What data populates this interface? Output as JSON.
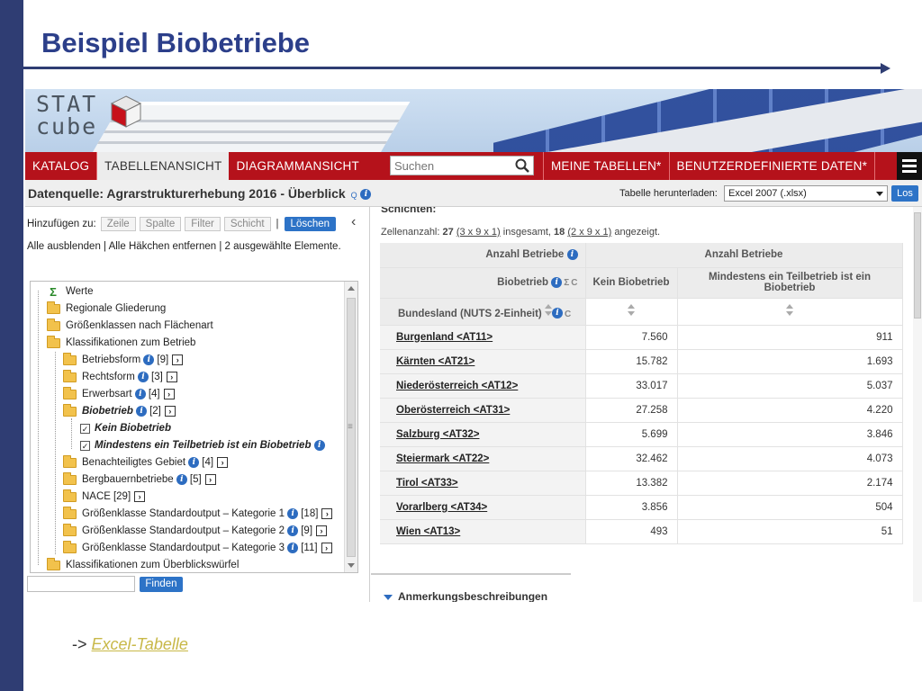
{
  "slide": {
    "title": "Beispiel Biobetriebe",
    "excel_prefix": "->",
    "excel_link": "Excel-Tabelle"
  },
  "app": {
    "logo_line1": "STAT",
    "logo_line2": "cube",
    "nav": {
      "katalog": "KATALOG",
      "tabellenansicht": "TABELLENANSICHT",
      "diagrammansicht": "DIAGRAMMANSICHT",
      "search_placeholder": "Suchen",
      "meine_tabellen": "MEINE TABELLEN*",
      "benutzerdefinierte": "BENUTZERDEFINIERTE DATEN*"
    },
    "toolbar": {
      "datasource": "Datenquelle: Agrarstrukturerhebung 2016 - Überblick",
      "datasource_icon_q": "Q",
      "download_label": "Tabelle herunterladen:",
      "download_format": "Excel 2007 (.xlsx)",
      "download_btn": "Los"
    },
    "left": {
      "add_label": "Hinzufügen zu:",
      "btn_zeile": "Zeile",
      "btn_spalte": "Spalte",
      "btn_filter": "Filter",
      "btn_schicht": "Schicht",
      "separator": "|",
      "btn_loeschen": "Löschen",
      "links": "Alle ausblenden | Alle Häkchen entfernen | 2 ausgewählte Elemente.",
      "find_btn": "Finden",
      "tree": [
        {
          "label": "Werte",
          "count": ""
        },
        {
          "label": "Regionale Gliederung",
          "count": ""
        },
        {
          "label": "Größenklassen nach Flächenart",
          "count": ""
        },
        {
          "label": "Klassifikationen zum Betrieb",
          "count": ""
        },
        {
          "label": "Betriebsform",
          "count": "[9]"
        },
        {
          "label": "Rechtsform",
          "count": "[3]"
        },
        {
          "label": "Erwerbsart",
          "count": "[4]"
        },
        {
          "label": "Biobetrieb",
          "count": "[2]"
        },
        {
          "label": "Kein Biobetrieb",
          "count": ""
        },
        {
          "label": "Mindestens ein Teilbetrieb ist ein Biobetrieb",
          "count": ""
        },
        {
          "label": "Benachteiligtes Gebiet",
          "count": "[4]"
        },
        {
          "label": "Bergbauernbetriebe",
          "count": "[5]"
        },
        {
          "label": "NACE",
          "count": "[29]"
        },
        {
          "label": "Größenklasse Standardoutput – Kategorie 1",
          "count": "[18]"
        },
        {
          "label": "Größenklasse Standardoutput – Kategorie 2",
          "count": "[9]"
        },
        {
          "label": "Größenklasse Standardoutput – Kategorie 3",
          "count": "[11]"
        },
        {
          "label": "Klassifikationen zum Überblickswürfel",
          "count": ""
        }
      ]
    },
    "right": {
      "schichten": "Schichten:",
      "zellen_prefix": "Zellenanzahl:",
      "zellen_total": "27",
      "zellen_dims1": "(3 x 9 x 1)",
      "zellen_mid": "insgesamt,",
      "zellen_shown": "18",
      "zellen_dims2": "(2 x 9 x 1)",
      "zellen_suffix": "angezeigt.",
      "hdr_anzahl_left": "Anzahl Betriebe",
      "hdr_anzahl_right": "Anzahl Betriebe",
      "hdr_bio_left": "Biobetrieb",
      "hdr_col1": "Kein Biobetrieb",
      "hdr_col2": "Mindestens ein Teilbetrieb ist ein Biobetrieb",
      "hdr_bundesland": "Bundesland (NUTS 2-Einheit)",
      "rows": [
        {
          "name": "Burgenland <AT11>",
          "kein": "7.560",
          "bio": "911"
        },
        {
          "name": "Kärnten <AT21>",
          "kein": "15.782",
          "bio": "1.693"
        },
        {
          "name": "Niederösterreich <AT12>",
          "kein": "33.017",
          "bio": "5.037"
        },
        {
          "name": "Oberösterreich <AT31>",
          "kein": "27.258",
          "bio": "4.220"
        },
        {
          "name": "Salzburg <AT32>",
          "kein": "5.699",
          "bio": "3.846"
        },
        {
          "name": "Steiermark <AT22>",
          "kein": "32.462",
          "bio": "4.073"
        },
        {
          "name": "Tirol <AT33>",
          "kein": "13.382",
          "bio": "2.174"
        },
        {
          "name": "Vorarlberg <AT34>",
          "kein": "3.856",
          "bio": "504"
        },
        {
          "name": "Wien <AT13>",
          "kein": "493",
          "bio": "51"
        }
      ],
      "anmerkung": "Anmerkungsbeschreibungen"
    }
  },
  "colors": {
    "slide_blue": "#2f3d73",
    "title_blue": "#2c3f8a",
    "nav_red": "#b5121b",
    "button_blue": "#2d73c7",
    "info_blue": "#2d6cc0",
    "link_olive": "#c8b848"
  }
}
